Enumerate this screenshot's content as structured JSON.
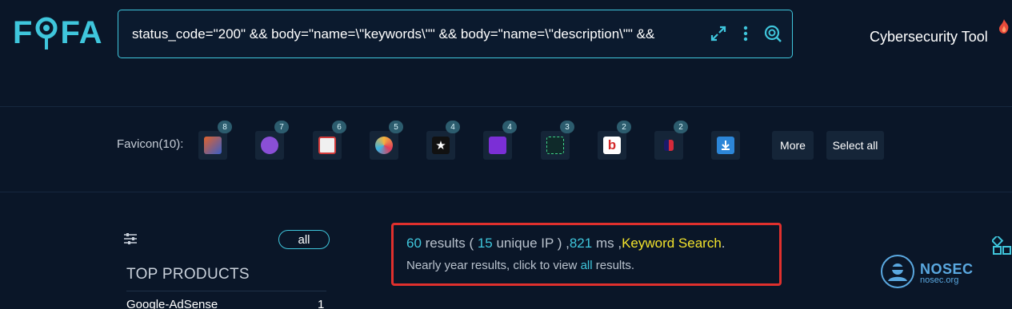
{
  "header": {
    "logo_left": "F",
    "logo_right": "FA",
    "search_query": "status_code=\"200\" && body=\"name=\\\"keywords\\\"\" && body=\"name=\\\"description\\\"\" &&",
    "brand_label": "Cybersecurity Tool"
  },
  "favicons": {
    "label": "Favicon(10):",
    "items": [
      {
        "count": "8",
        "icon": "orange-blue-favicon",
        "color": "#e2622b"
      },
      {
        "count": "7",
        "icon": "purple-circle-favicon",
        "color": "#8a4fd6"
      },
      {
        "count": "6",
        "icon": "red-white-favicon",
        "color": "#f0f0f0"
      },
      {
        "count": "5",
        "icon": "colorful-circle-favicon",
        "color": "#f4b43c"
      },
      {
        "count": "4",
        "icon": "star-favicon",
        "color": "#111111"
      },
      {
        "count": "4",
        "icon": "purple-d-favicon",
        "color": "#7b2fd6"
      },
      {
        "count": "3",
        "icon": "green-target-favicon",
        "color": "#0f2a2a"
      },
      {
        "count": "2",
        "icon": "red-b-favicon",
        "color": "#ffffff"
      },
      {
        "count": "2",
        "icon": "blue-red-favicon",
        "color": "#1a1a6a"
      },
      {
        "icon": "download-favicon",
        "color": "#2c86d8"
      }
    ],
    "more_label": "More",
    "select_all_label": "Select all"
  },
  "sidebar": {
    "all_label": "all",
    "top_products_title": "TOP PRODUCTS",
    "products": [
      {
        "name": "Google-AdSense",
        "count": "1"
      }
    ]
  },
  "results": {
    "count": "60",
    "results_word": " results ( ",
    "unique_ip": "15",
    "unique_ip_word": " unique IP ) ,",
    "ms": "821",
    "ms_word": " ms ,",
    "keyword_search": "Keyword Search",
    "period": ".",
    "line2_prefix": "Nearly year results, click to view ",
    "line2_link": "all",
    "line2_suffix": " results."
  },
  "watermark": {
    "title": "NOSEC",
    "subtitle": "nosec.org"
  },
  "colors": {
    "accent": "#3fc6dc",
    "keyword": "#f2e22c",
    "highlight_border": "#e0302d",
    "background": "#0a1628"
  }
}
